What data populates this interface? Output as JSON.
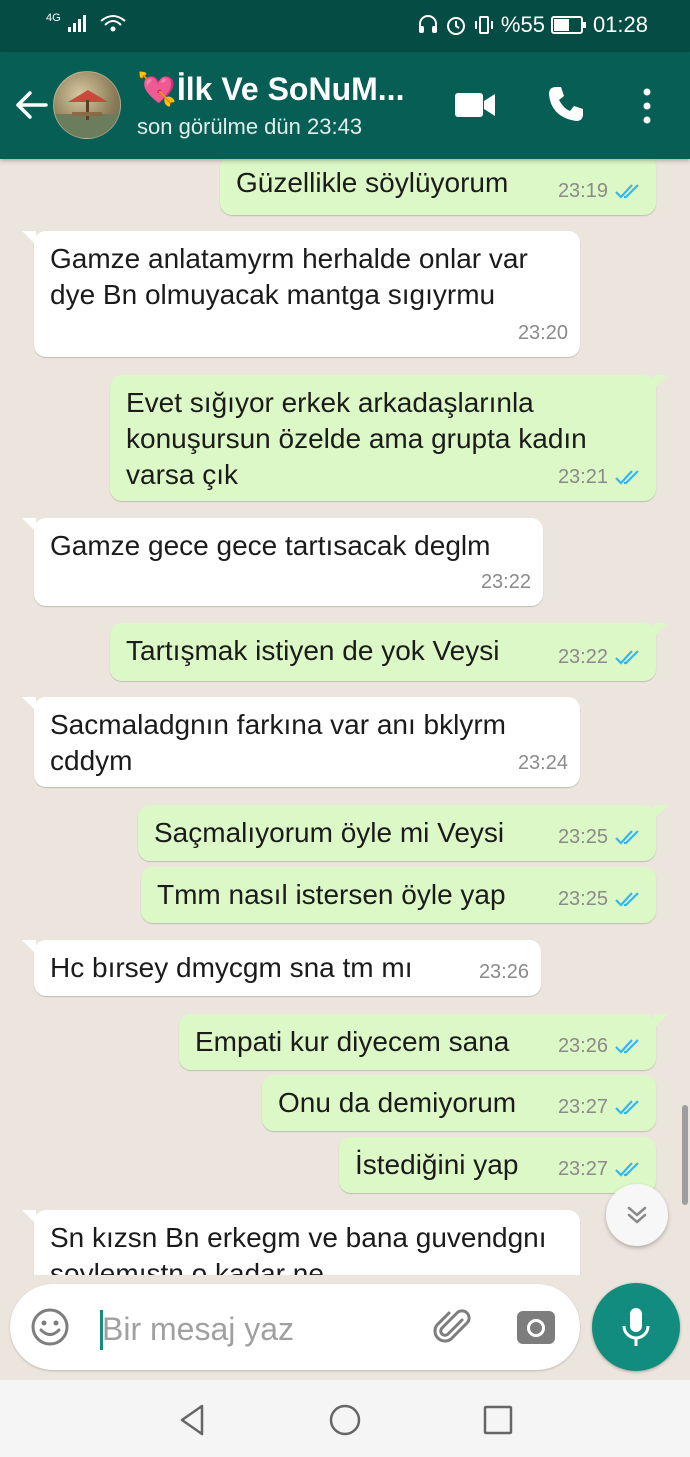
{
  "status_bar": {
    "network": "4G",
    "battery": "%55",
    "time": "01:28"
  },
  "header": {
    "contact_name": "💘İlk Ve SoNuM...",
    "last_seen": "son görülme dün 23:43",
    "icons": [
      "back-arrow-icon",
      "video-call-icon",
      "phone-icon",
      "more-vert-icon"
    ]
  },
  "messages": [
    {
      "dir": "out",
      "text": "Güzellikle söylüyorum",
      "time": "23:19",
      "read": true
    },
    {
      "dir": "in",
      "text": "Gamze anlatamyrm herhalde onlar var dye Bn olmuyacak mantga sıgıyrmu",
      "time": "23:20"
    },
    {
      "dir": "out",
      "text": "Evet sığıyor erkek arkadaşlarınla konuşursun özelde ama grupta kadın varsa çık",
      "time": "23:21",
      "read": true
    },
    {
      "dir": "in",
      "text": "Gamze gece gece tartısacak deglm",
      "time": "23:22"
    },
    {
      "dir": "out",
      "text": "Tartışmak istiyen de yok Veysi",
      "time": "23:22",
      "read": true
    },
    {
      "dir": "in",
      "text": "Sacmaladgnın farkına var anı bklyrm cddym",
      "time": "23:24"
    },
    {
      "dir": "out",
      "text": "Saçmalıyorum öyle mi Veysi",
      "time": "23:25",
      "read": true
    },
    {
      "dir": "out",
      "text": "Tmm nasıl istersen öyle yap",
      "time": "23:25",
      "read": true
    },
    {
      "dir": "in",
      "text": "Hc bırsey dmycgm sna tm mı",
      "time": "23:26"
    },
    {
      "dir": "out",
      "text": "Empati kur diyecem sana",
      "time": "23:26",
      "read": true
    },
    {
      "dir": "out",
      "text": "Onu da demiyorum",
      "time": "23:27",
      "read": true
    },
    {
      "dir": "out",
      "text": "İstediğini yap",
      "time": "23:27",
      "read": true
    },
    {
      "dir": "in",
      "text": "Sn kızsn Bn erkegm ve bana guvendgnı soylemıstn o kadar ne",
      "time": ""
    }
  ],
  "composer": {
    "placeholder": "Bir mesaj yaz",
    "icons": [
      "emoji-icon",
      "attach-icon",
      "camera-icon",
      "mic-icon"
    ]
  },
  "colors": {
    "header": "#075e54",
    "status_bar": "#054d44",
    "outgoing_bubble": "#dcf8c6",
    "incoming_bubble": "#ffffff",
    "read_tick": "#34b7f1",
    "accent": "#128c7e"
  }
}
